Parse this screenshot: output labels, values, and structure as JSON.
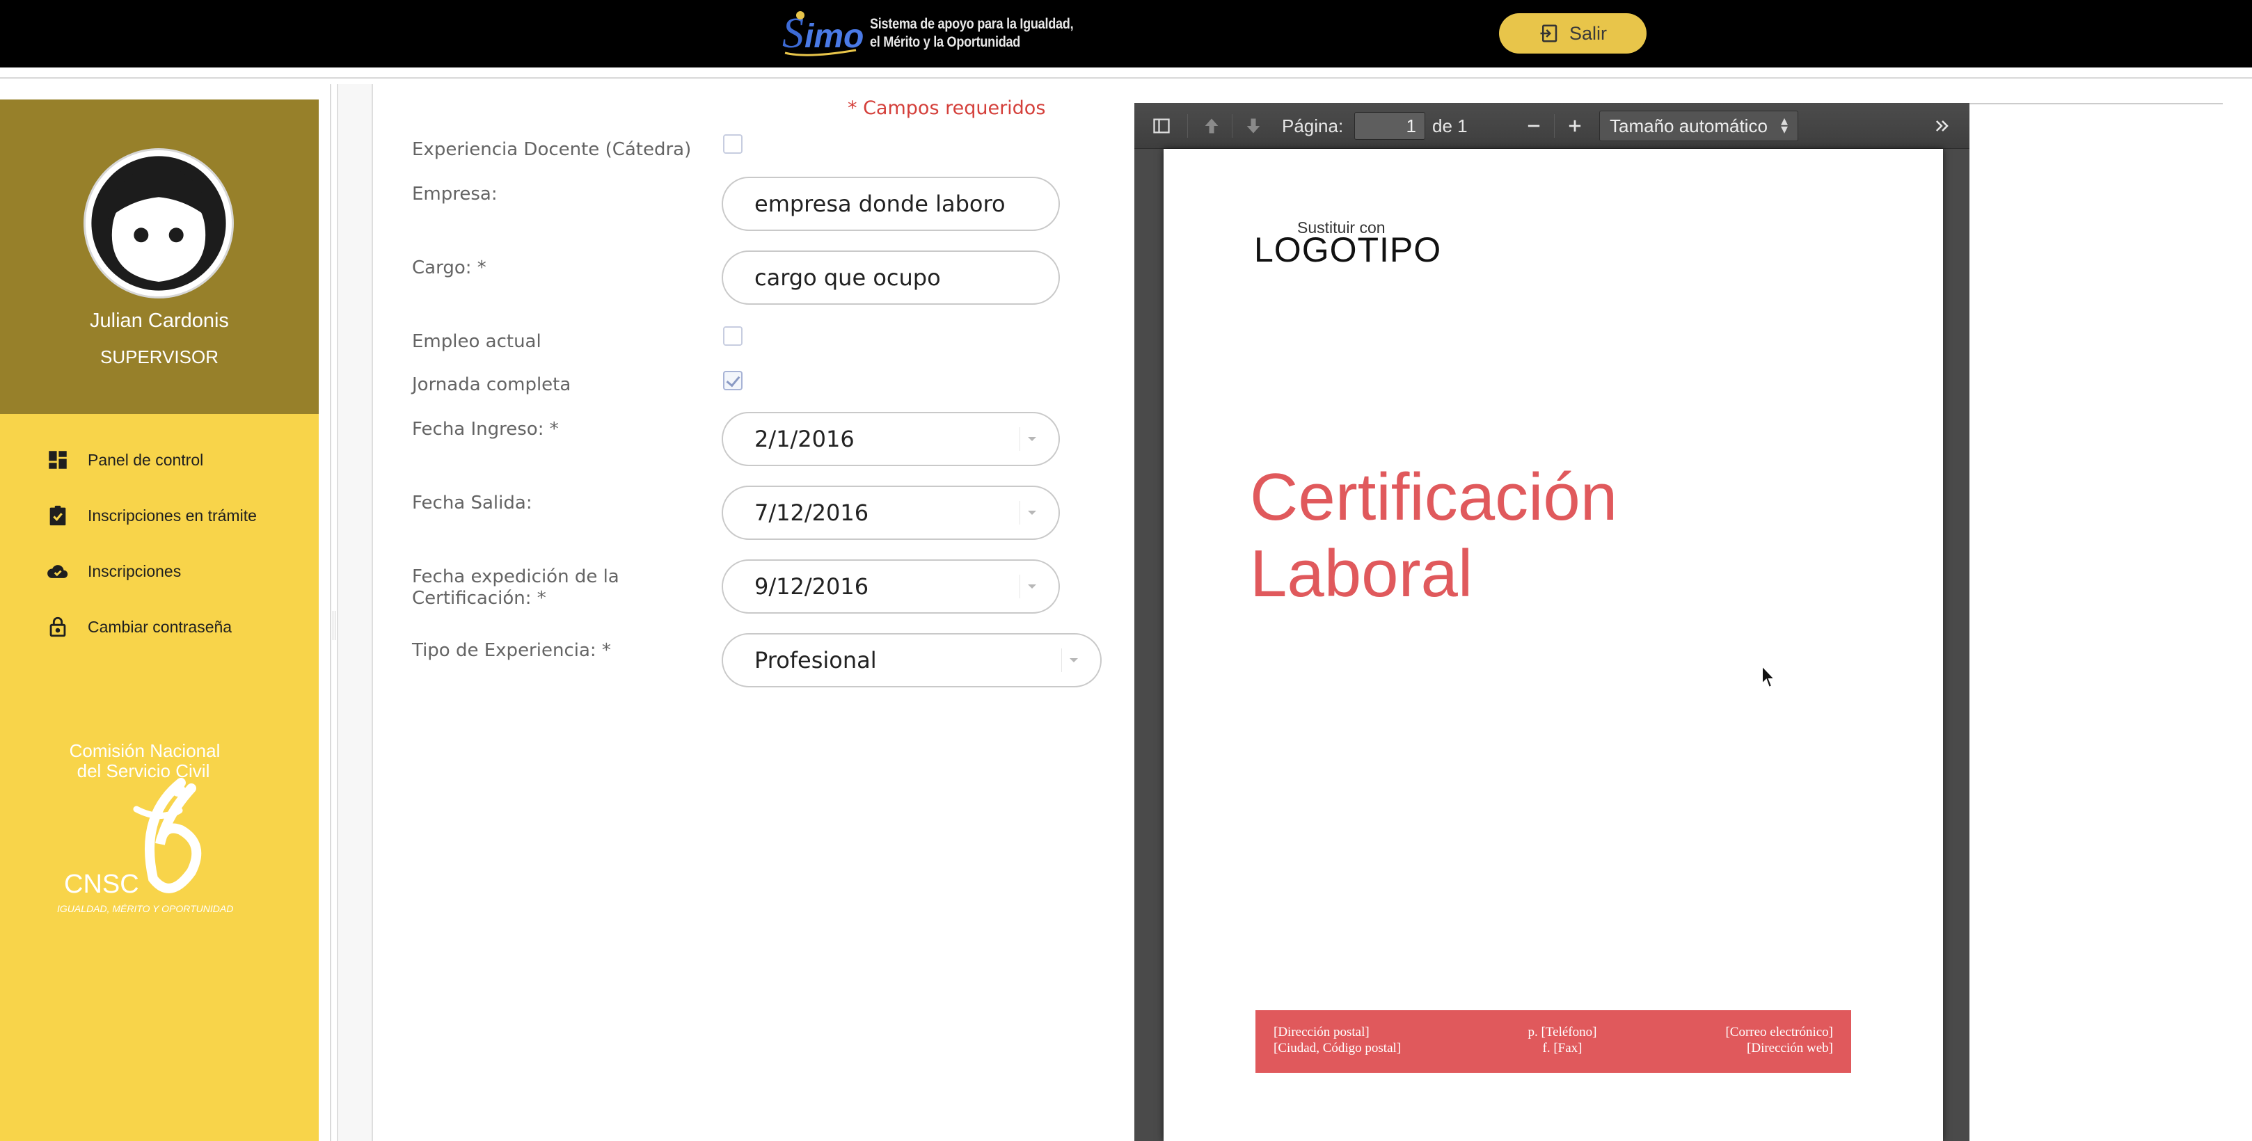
{
  "topbar": {
    "brand_tagline_1": "Sistema de apoyo para la Igualdad,",
    "brand_tagline_2": "el Mérito y la Oportunidad",
    "logout_label": "Salir"
  },
  "sidebar": {
    "user_name": "Julian Cardonis",
    "user_role": "SUPERVISOR",
    "items": [
      {
        "label": "Panel de control",
        "icon": "dashboard-icon"
      },
      {
        "label": "Inscripciones en trámite",
        "icon": "clipboard-check-icon"
      },
      {
        "label": "Inscripciones",
        "icon": "cloud-check-icon"
      },
      {
        "label": "Cambiar contraseña",
        "icon": "lock-icon"
      }
    ],
    "org_name_1": "Comisión Nacional",
    "org_name_2": "del Servicio Civil",
    "org_short": "CNSC",
    "org_slogan": "IGUALDAD, MÉRITO Y OPORTUNIDAD"
  },
  "form": {
    "required_note": "* Campos requeridos",
    "teaching_label": "Experiencia Docente (Cátedra)",
    "teaching_checked": false,
    "company_label": "Empresa:",
    "company_value": "empresa donde laboro",
    "position_label": "Cargo: *",
    "position_value": "cargo que ocupo",
    "current_job_label": "Empleo actual",
    "current_job_checked": false,
    "full_time_label": "Jornada completa",
    "full_time_checked": true,
    "start_date_label": "Fecha Ingreso: *",
    "start_date_value": "2/1/2016",
    "end_date_label": "Fecha Salida:",
    "end_date_value": "7/12/2016",
    "issue_date_label_1": "Fecha expedición de la",
    "issue_date_label_2": "Certificación: *",
    "issue_date_value": "9/12/2016",
    "experience_type_label": "Tipo de Experiencia: *",
    "experience_type_value": "Profesional"
  },
  "pdf_viewer": {
    "page_label": "Página:",
    "page_current": "1",
    "page_total": "de 1",
    "zoom_value": "Tamaño automático",
    "document": {
      "logo_sub": "Sustituir con",
      "logo_main": "LOGOTIPO",
      "title_line_1": "Certificación",
      "title_line_2": "Laboral",
      "footer_address": "[Dirección postal]",
      "footer_city": "[Ciudad, Código postal]",
      "footer_phone": "p. [Teléfono]",
      "footer_fax": "f. [Fax]",
      "footer_email": "[Correo electrónico]",
      "footer_web": "[Dirección web]"
    }
  },
  "colors": {
    "topbar": "#000000",
    "sidebar_profile": "#97802a",
    "sidebar": "#f8d44a",
    "logout_button": "#e8c54a",
    "required_red": "#d43f3a",
    "certificate_accent": "#e0595c",
    "pdf_toolbar": "#474747"
  }
}
